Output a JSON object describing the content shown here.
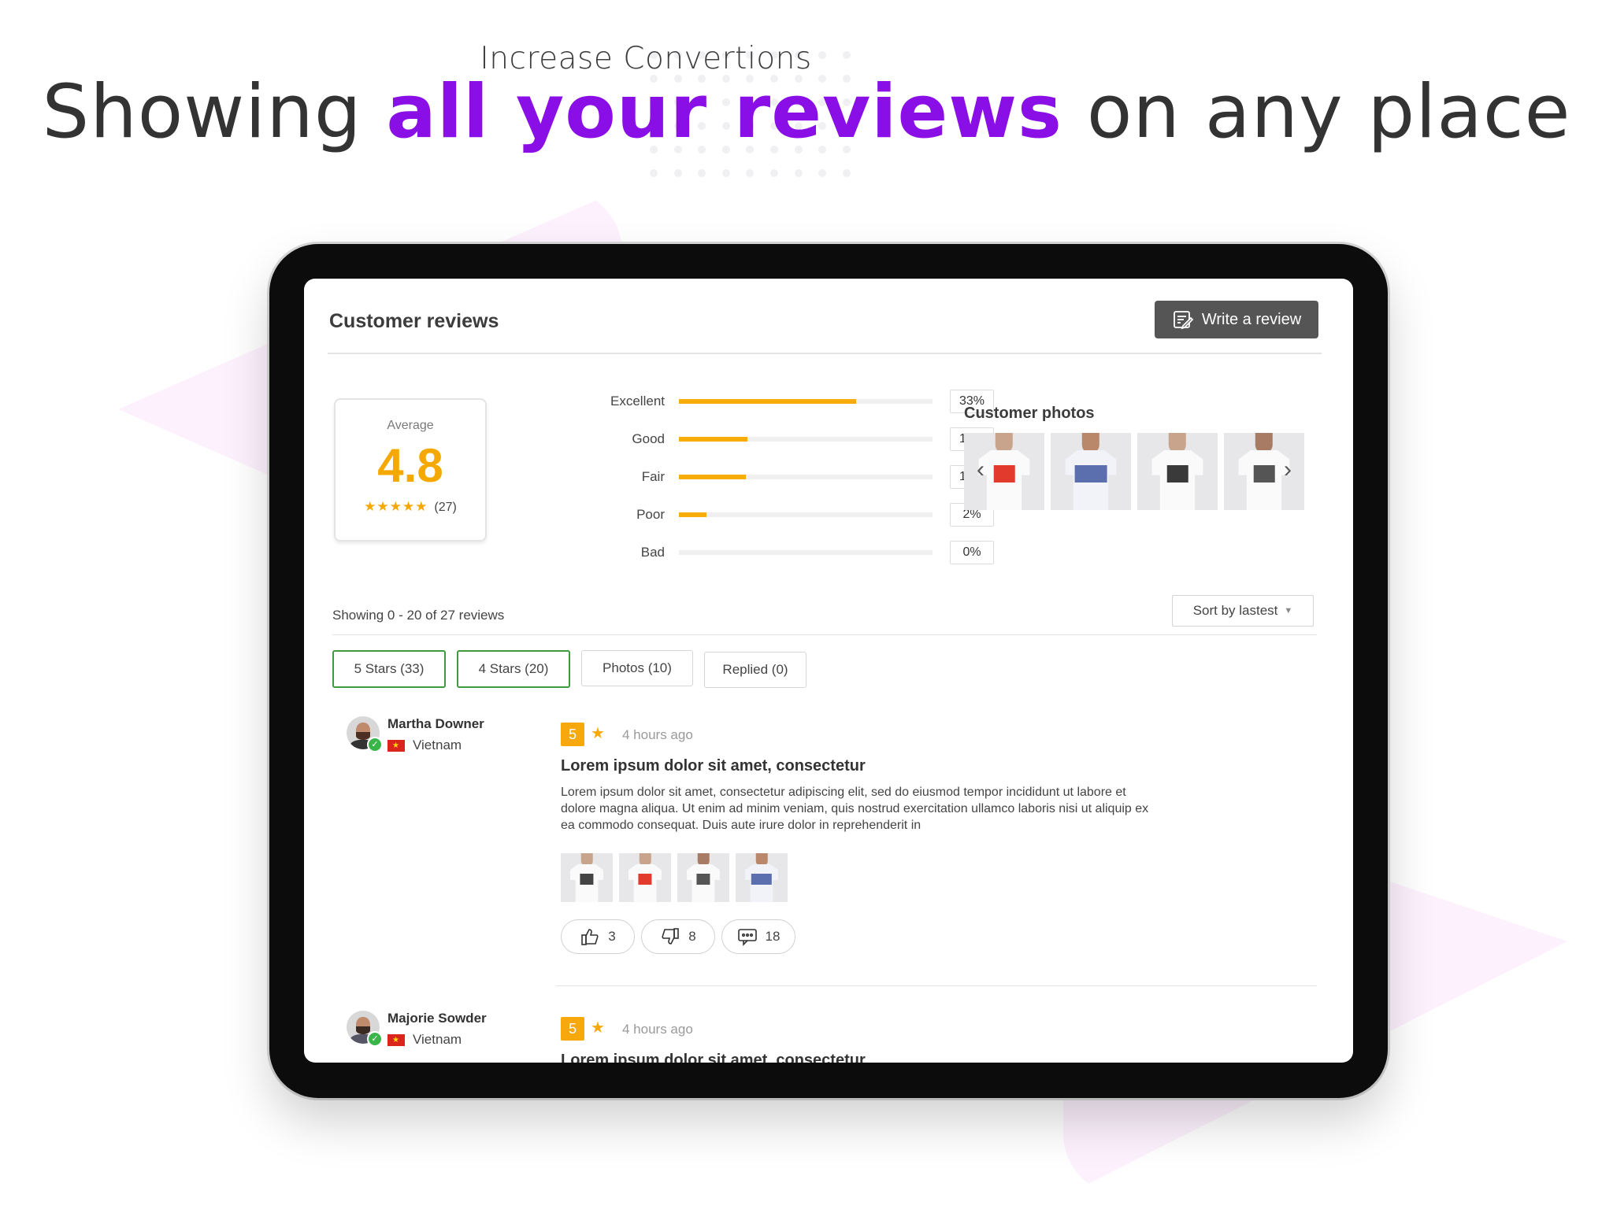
{
  "marketing": {
    "subtitle": "Increase Convertions",
    "headline_pre": "Showing ",
    "headline_accent": "all your reviews",
    "headline_post": " on any place"
  },
  "widget": {
    "title": "Customer reviews",
    "write_button": "Write a review",
    "average_label": "Average",
    "average_value": "4.8",
    "average_stars": "★★★★★",
    "review_count": "(27)",
    "distribution": [
      {
        "label": "Excellent",
        "percent_text": "33%",
        "fill": 0.7
      },
      {
        "label": "Good",
        "percent_text": "10%",
        "fill": 0.27
      },
      {
        "label": "Fair",
        "percent_text": "10%",
        "fill": 0.265
      },
      {
        "label": "Poor",
        "percent_text": "2%",
        "fill": 0.11
      },
      {
        "label": "Bad",
        "percent_text": "0%",
        "fill": 0
      }
    ],
    "customer_photos_title": "Customer photos",
    "prev_arrow": "‹",
    "next_arrow": "›",
    "showing_text": "Showing 0 - 20 of 27 reviews",
    "sort_label": "Sort by lastest",
    "sort_caret": "▼",
    "filters": [
      {
        "label": "5 Stars (33)",
        "active": true
      },
      {
        "label": "4 Stars (20)",
        "active": true
      },
      {
        "label": "Photos (10)",
        "active": false
      },
      {
        "label": "Replied (0)",
        "active": false
      }
    ],
    "reviews": [
      {
        "name": "Martha Downer",
        "country": "Vietnam",
        "rating": "5",
        "time": "4 hours ago",
        "title": "Lorem ipsum dolor sit amet, consectetur",
        "body": "Lorem ipsum dolor sit amet, consectetur adipiscing elit, sed do eiusmod tempor incididunt ut labore et dolore magna aliqua. Ut enim ad minim veniam, quis nostrud exercitation ullamco laboris nisi ut aliquip ex ea commodo consequat. Duis aute irure dolor in reprehenderit in",
        "likes": "3",
        "dislikes": "8",
        "comments": "18"
      },
      {
        "name": "Majorie Sowder",
        "country": "Vietnam",
        "rating": "5",
        "time": "4 hours ago",
        "title": "Lorem ipsum dolor sit amet, consectetur"
      }
    ]
  },
  "colors": {
    "accent_purple": "#8a0ee6",
    "rating_orange": "#f7ac0a",
    "button_dark": "#555555",
    "filter_active_green": "#3e9a3e",
    "triangle_pink": "#fdf1fd"
  }
}
